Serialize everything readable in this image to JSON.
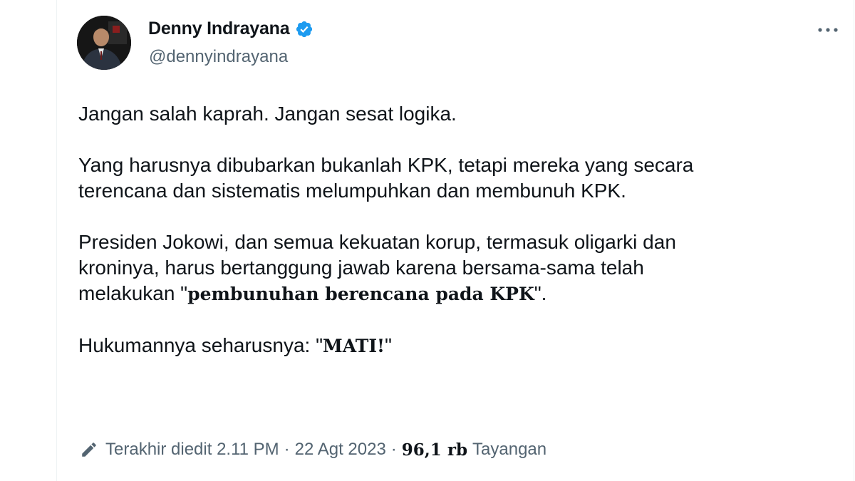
{
  "author": {
    "name": "Denny Indrayana",
    "handle": "@dennyindrayana",
    "verified": true,
    "verified_color": "#1d9bf0"
  },
  "tweet": {
    "paragraph_1": "Jangan salah kaprah. Jangan sesat logika.",
    "paragraph_2": "Yang harusnya dibubarkan bukanlah KPK, tetapi mereka yang secara\nterencana dan sistematis melumpuhkan dan membunuh KPK.",
    "paragraph_3_plain": "Presiden Jokowi, dan semua kekuatan korup, termasuk oligarki dan\nkroninya, harus bertanggung jawab karena bersama-sama telah\nmelakukan \"",
    "paragraph_3_bold": "pembunuhan berencana pada KPK",
    "paragraph_3_end": "\".",
    "paragraph_4_plain": "Hukumannya seharusnya: \"",
    "paragraph_4_bold": "MATI!",
    "paragraph_4_end": "\""
  },
  "meta": {
    "edited_label": "Terakhir diedit 2.11 PM",
    "separator": "·",
    "date": "22 Agt 2023",
    "views_count": "96,1 rb",
    "views_label": "Tayangan"
  },
  "icons": {
    "more": "more-horizontal-icon",
    "verified": "verified-badge-icon",
    "edited": "pencil-icon"
  }
}
